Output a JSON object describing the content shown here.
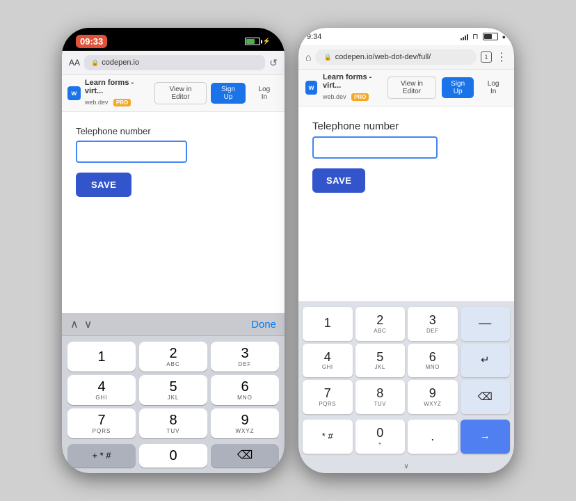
{
  "leftPhone": {
    "statusBar": {
      "time": "09:33",
      "batteryLevel": "charging"
    },
    "browser": {
      "aaLabel": "AA",
      "lockIcon": "🔒",
      "urlText": "codepen.io",
      "reloadIcon": "↺"
    },
    "toolbar": {
      "logoText": "w",
      "title": "Learn forms - virt...",
      "subtitle": "web.dev",
      "proBadge": "PRO",
      "viewEditorBtn": "View in Editor",
      "signUpBtn": "Sign Up",
      "logInBtn": "Log In"
    },
    "page": {
      "fieldLabel": "Telephone number",
      "inputValue": "",
      "saveBtn": "SAVE"
    },
    "keyboardToolbar": {
      "doneBtn": "Done"
    },
    "keyboard": {
      "rows": [
        [
          "1",
          "",
          "2",
          "ABC",
          "3",
          "DEF"
        ],
        [
          "4",
          "GHI",
          "5",
          "JKL",
          "6",
          "MNO"
        ],
        [
          "7",
          "PQRS",
          "8",
          "TUV",
          "9",
          "WXYZ"
        ]
      ],
      "bottomRow": [
        "+ * #",
        "0",
        "⌫"
      ]
    }
  },
  "rightPhone": {
    "statusBar": {
      "time": "9:34",
      "icons": [
        "sim",
        "wifi",
        "battery"
      ]
    },
    "browser": {
      "homeIcon": "⌂",
      "lockIcon": "🔒",
      "urlText": "codepen.io/web-dot-dev/full/",
      "tabCount": "1",
      "moreIcon": "⋮"
    },
    "toolbar": {
      "logoText": "w",
      "title": "Learn forms - virt...",
      "subtitle": "web.dev",
      "proBadge": "PRO",
      "viewEditorBtn": "View in Editor",
      "signUpBtn": "Sign Up",
      "logInBtn": "Log In"
    },
    "page": {
      "fieldLabel": "Telephone number",
      "inputValue": "",
      "saveBtn": "SAVE"
    },
    "keyboard": {
      "keys": [
        {
          "num": "1",
          "letters": ""
        },
        {
          "num": "2",
          "letters": "ABC"
        },
        {
          "num": "3",
          "letters": "DEF"
        },
        {
          "num": "—",
          "letters": ""
        },
        {
          "num": "4",
          "letters": "GHI"
        },
        {
          "num": "5",
          "letters": "JKL"
        },
        {
          "num": "6",
          "letters": "MNO"
        },
        {
          "num": "↵",
          "letters": ""
        },
        {
          "num": "7",
          "letters": "PQRS"
        },
        {
          "num": "8",
          "letters": "TUV"
        },
        {
          "num": "9",
          "letters": "WXYZ"
        },
        {
          "num": "⌫",
          "letters": ""
        },
        {
          "num": "* #",
          "letters": ""
        },
        {
          "num": "0",
          "letters": "+"
        },
        {
          "num": ".",
          "letters": ""
        },
        {
          "num": "→",
          "letters": ""
        }
      ]
    },
    "bottomBar": {
      "chevron": "∨"
    }
  }
}
